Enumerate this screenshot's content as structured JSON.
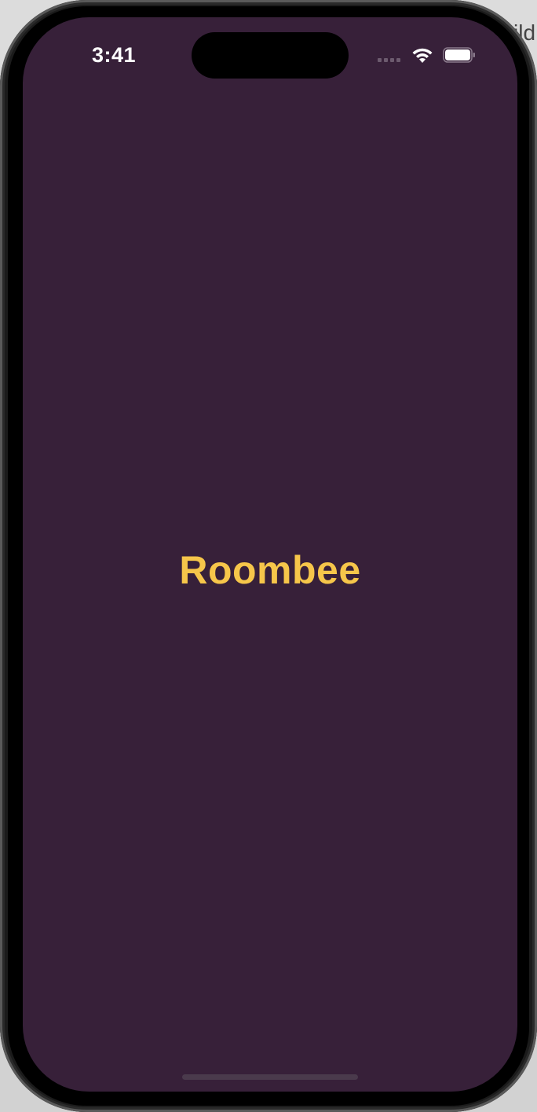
{
  "status_bar": {
    "time": "3:41",
    "icons": [
      "cellular-signal-icon",
      "wifi-icon",
      "battery-icon"
    ]
  },
  "app": {
    "title": "Roombee"
  },
  "backdrop": {
    "partial_text": "ild"
  },
  "colors": {
    "screen_background": "#372039",
    "title": "#f6c64a",
    "status_text": "#ffffff"
  }
}
